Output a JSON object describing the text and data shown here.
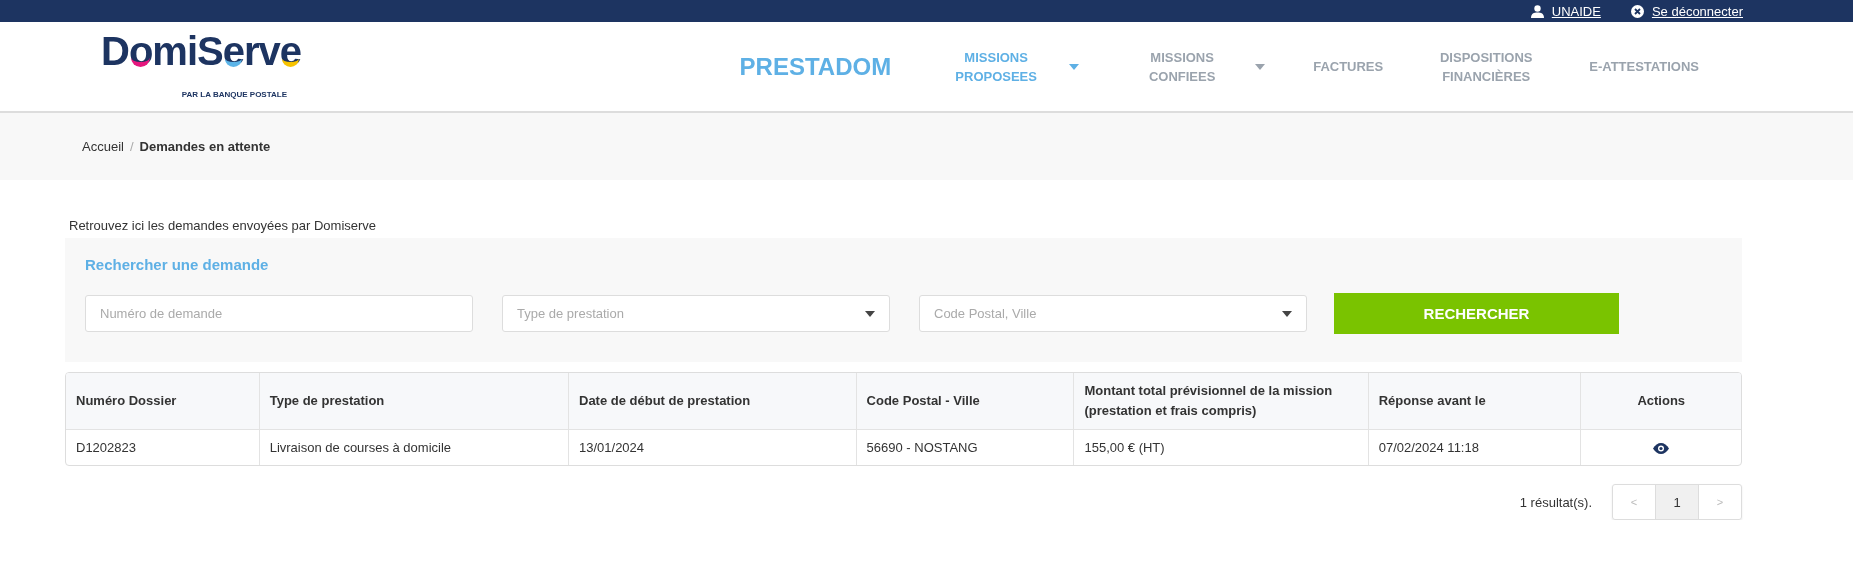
{
  "top_bar": {
    "user": "UNAIDE",
    "logout": "Se déconnecter"
  },
  "header": {
    "logo": {
      "letters": [
        {
          "text": "D"
        },
        {
          "text": "o",
          "color": "#e5177e"
        },
        {
          "text": "miS"
        },
        {
          "text": "e",
          "color": "#5bb4e8"
        },
        {
          "text": "rv"
        },
        {
          "text": "e",
          "color": "#f7c300"
        }
      ],
      "tagline": "PAR LA BANQUE POSTALE"
    },
    "brand": "PRESTADOM",
    "nav": [
      {
        "label": "MISSIONS PROPOSEES",
        "selected": true,
        "dropdown": true
      },
      {
        "label": "MISSIONS CONFIEES",
        "selected": false,
        "dropdown": true
      },
      {
        "label": "FACTURES",
        "selected": false,
        "dropdown": false
      },
      {
        "label": "DISPOSITIONS FINANCIÈRES",
        "selected": false,
        "dropdown": false
      },
      {
        "label": "E-ATTESTATIONS",
        "selected": false,
        "dropdown": false
      }
    ]
  },
  "breadcrumb": [
    "Accueil",
    "Demandes en attente"
  ],
  "breadcrumb_separator": "/",
  "intro": "Retrouvez ici les demandes envoyées par Domiserve",
  "search": {
    "title": "Rechercher une demande",
    "fields": [
      {
        "kind": "text",
        "placeholder": "Numéro de demande"
      },
      {
        "kind": "select",
        "placeholder": "Type de prestation"
      },
      {
        "kind": "select",
        "placeholder": "Code Postal, Ville"
      }
    ],
    "button": "RECHERCHER"
  },
  "table": {
    "columns": [
      "Numéro Dossier",
      "Type de prestation",
      "Date de début de prestation",
      "Code Postal - Ville",
      "Montant total prévisionnel de la mission (prestation et frais compris)",
      "Réponse avant le",
      "Actions"
    ],
    "rows": [
      {
        "cells": [
          "D1202823",
          "Livraison de courses à domicile",
          "13/01/2024",
          "56690 - NOSTANG",
          "155,00 € (HT)",
          "07/02/2024 11:18"
        ]
      }
    ]
  },
  "pagination": {
    "count": "1 résultat(s).",
    "prev": "<",
    "pages": [
      {
        "label": "1",
        "selected": true
      }
    ],
    "next": ">"
  }
}
